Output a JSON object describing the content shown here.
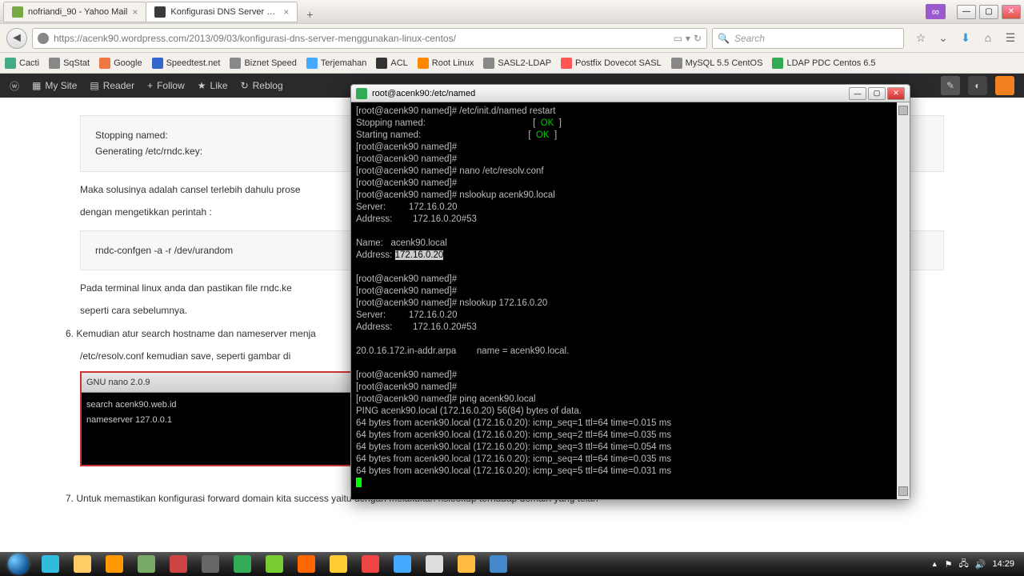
{
  "firefox": {
    "tabs": [
      {
        "label": "nofriandi_90 - Yahoo Mail"
      },
      {
        "label": "Konfigurasi DNS Server Pa..."
      }
    ],
    "url": "https://acenk90.wordpress.com/2013/09/03/konfigurasi-dns-server-menggunakan-linux-centos/",
    "search_placeholder": "Search",
    "purple_badge": "∞",
    "bookmarks": [
      {
        "label": "Cacti",
        "color": "#4a8"
      },
      {
        "label": "SqStat",
        "color": "#888"
      },
      {
        "label": "Google",
        "color": "#e74"
      },
      {
        "label": "Speedtest.net",
        "color": "#36c"
      },
      {
        "label": "Biznet Speed",
        "color": "#888"
      },
      {
        "label": "Terjemahan",
        "color": "#4af"
      },
      {
        "label": "ACL",
        "color": "#333"
      },
      {
        "label": "Root Linux",
        "color": "#f80"
      },
      {
        "label": "SASL2-LDAP",
        "color": "#888"
      },
      {
        "label": "Postfix Dovecot SASL",
        "color": "#f55"
      },
      {
        "label": "MySQL 5.5 CentOS",
        "color": "#888"
      },
      {
        "label": "LDAP PDC Centos 6.5",
        "color": "#3a5"
      }
    ]
  },
  "wpbar": {
    "mysite": "My Site",
    "reader": "Reader",
    "follow": "Follow",
    "like": "Like",
    "reblog": "Reblog"
  },
  "article": {
    "code1_l1": "Stopping named:",
    "code1_l2": "Generating /etc/rndc.key:",
    "p1": "Maka solusinya adalah cansel terlebih dahulu prose",
    "p2": "dengan mengetikkan perintah :",
    "code2": "rndc-confgen -a -r /dev/urandom",
    "p3": "Pada terminal linux anda dan pastikan file rndc.ke",
    "p4": "seperti cara sebelumnya.",
    "step6_num": "6.",
    "step6": "Kemudian atur search hostname dan nameserver menja",
    "step6b": "/etc/resolv.conf kemudian save, seperti gambar di",
    "nano_title": "GNU nano 2.0.9",
    "nano_l1": "search acenk90.web.id",
    "nano_l2": "nameserver 127.0.0.1",
    "step7_num": "7.",
    "step7": "Untuk memastikan konfigurasi forward domain kita success yaitu dengan melakukan nslookup terhadap domain yang telah"
  },
  "terminal": {
    "title": "root@acenk90:/etc/named",
    "lines": [
      "[root@acenk90 named]# /etc/init.d/named restart",
      "Stopping named:                                          [  OK  ]",
      "Starting named:                                          [  OK  ]",
      "[root@acenk90 named]#",
      "[root@acenk90 named]#",
      "[root@acenk90 named]# nano /etc/resolv.conf",
      "[root@acenk90 named]#",
      "[root@acenk90 named]# nslookup acenk90.local",
      "Server:         172.16.0.20",
      "Address:        172.16.0.20#53",
      "",
      "Name:   acenk90.local",
      "Address: {HL}172.16.0.20{/HL}",
      "",
      "[root@acenk90 named]#",
      "[root@acenk90 named]#",
      "[root@acenk90 named]# nslookup 172.16.0.20",
      "Server:         172.16.0.20",
      "Address:        172.16.0.20#53",
      "",
      "20.0.16.172.in-addr.arpa        name = acenk90.local.",
      "",
      "[root@acenk90 named]#",
      "[root@acenk90 named]#",
      "[root@acenk90 named]# ping acenk90.local",
      "PING acenk90.local (172.16.0.20) 56(84) bytes of data.",
      "64 bytes from acenk90.local (172.16.0.20): icmp_seq=1 ttl=64 time=0.015 ms",
      "64 bytes from acenk90.local (172.16.0.20): icmp_seq=2 ttl=64 time=0.035 ms",
      "64 bytes from acenk90.local (172.16.0.20): icmp_seq=3 ttl=64 time=0.054 ms",
      "64 bytes from acenk90.local (172.16.0.20): icmp_seq=4 ttl=64 time=0.035 ms",
      "64 bytes from acenk90.local (172.16.0.20): icmp_seq=5 ttl=64 time=0.031 ms"
    ]
  },
  "taskbar": {
    "clock": "14:29",
    "icons": [
      {
        "name": "ie",
        "color": "#3bd"
      },
      {
        "name": "explorer",
        "color": "#fc6"
      },
      {
        "name": "wmp",
        "color": "#f90"
      },
      {
        "name": "gimp",
        "color": "#7a6"
      },
      {
        "name": "app1",
        "color": "#c44"
      },
      {
        "name": "app2",
        "color": "#666"
      },
      {
        "name": "chrome1",
        "color": "#3a5"
      },
      {
        "name": "notepadpp",
        "color": "#7c3"
      },
      {
        "name": "firefox",
        "color": "#f60"
      },
      {
        "name": "app3",
        "color": "#fc3"
      },
      {
        "name": "chrome",
        "color": "#e44"
      },
      {
        "name": "msg",
        "color": "#4af"
      },
      {
        "name": "mail",
        "color": "#ddd"
      },
      {
        "name": "face",
        "color": "#fb4"
      },
      {
        "name": "putty",
        "color": "#48c"
      }
    ]
  }
}
